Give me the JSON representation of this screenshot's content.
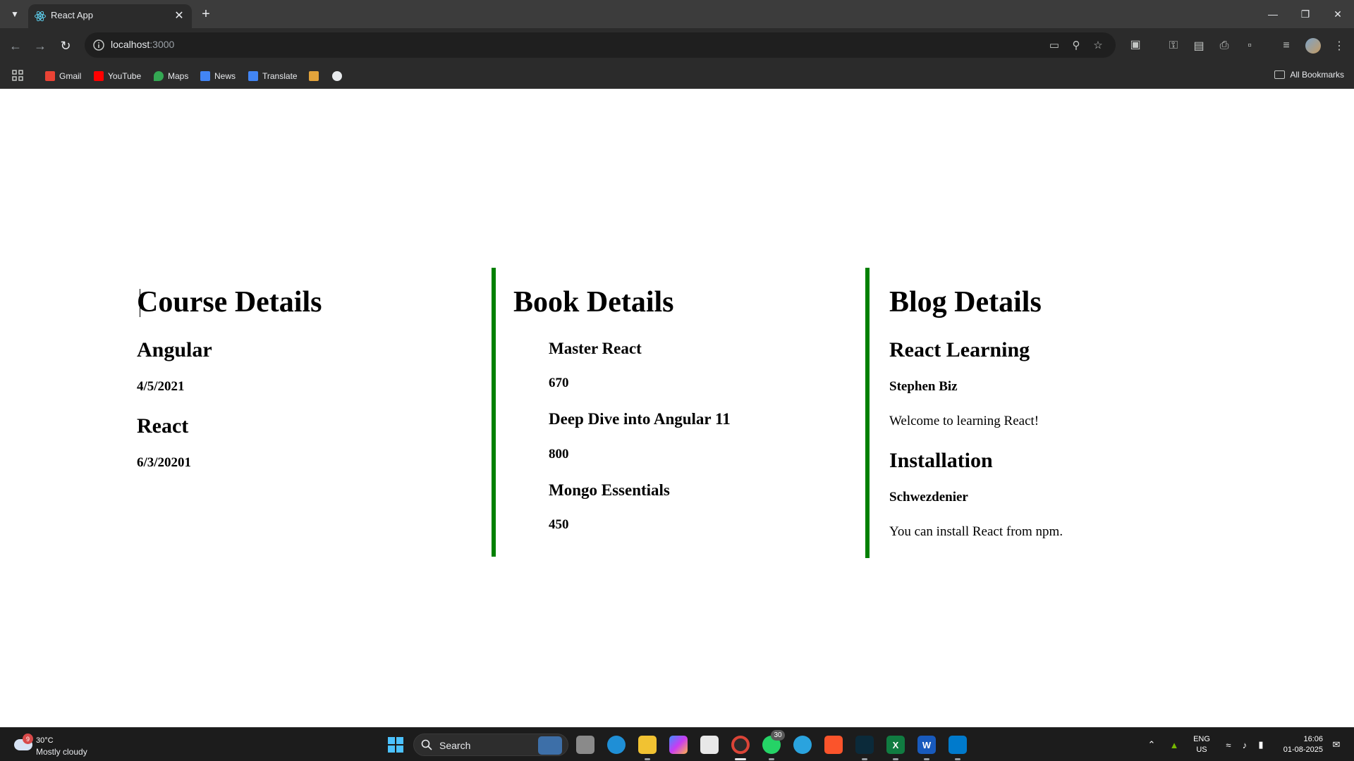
{
  "browser": {
    "tab_title": "React App",
    "url_host": "localhost",
    "url_port": ":3000",
    "bookmarks": [
      {
        "label": "Gmail",
        "icon": "gmail-icon",
        "color": "#ea4335"
      },
      {
        "label": "YouTube",
        "icon": "youtube-icon",
        "color": "#ff0000"
      },
      {
        "label": "Maps",
        "icon": "maps-icon",
        "color": "#34a853"
      },
      {
        "label": "News",
        "icon": "news-icon",
        "color": "#4285f4"
      },
      {
        "label": "Translate",
        "icon": "translate-icon",
        "color": "#4285f4"
      }
    ],
    "all_bookmarks_label": "All Bookmarks"
  },
  "course": {
    "heading": "Course Details",
    "items": [
      {
        "name": "Angular",
        "date": "4/5/2021"
      },
      {
        "name": "React",
        "date": "6/3/20201"
      }
    ]
  },
  "book": {
    "heading": "Book Details",
    "items": [
      {
        "name": "Master React",
        "price": "670"
      },
      {
        "name": "Deep Dive into Angular 11",
        "price": "800"
      },
      {
        "name": "Mongo Essentials",
        "price": "450"
      }
    ]
  },
  "blog": {
    "heading": "Blog Details",
    "items": [
      {
        "title": "React Learning",
        "author": "Stephen Biz",
        "content": "Welcome to learning React!"
      },
      {
        "title": "Installation",
        "author": "Schwezdenier",
        "content": "You can install React from npm."
      }
    ]
  },
  "colors": {
    "divider": "#008000",
    "chrome_bg": "#3c3c3c",
    "toolbar_bg": "#2b2b2b",
    "taskbar_bg": "#1c1c1c"
  },
  "taskbar": {
    "weather_temp": "30°C",
    "weather_desc": "Mostly cloudy",
    "weather_badge": "9",
    "search_label": "Search",
    "whatsapp_badge": "30",
    "lang_top": "ENG",
    "lang_bottom": "US",
    "time": "16:06",
    "date": "01-08-2025"
  }
}
